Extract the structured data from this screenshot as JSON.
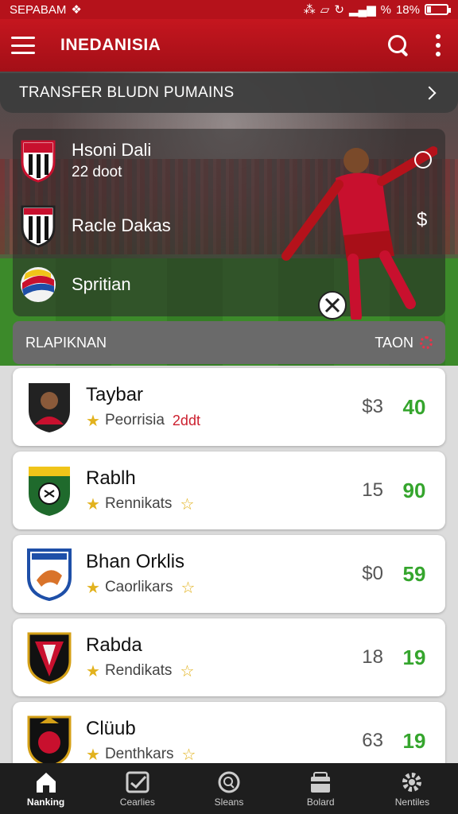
{
  "status_bar": {
    "time": "SEPABAM",
    "battery_text": "18%",
    "signal_text": "%",
    "battery_level": 0.18
  },
  "app_bar": {
    "title": "INEDANISIA",
    "menu_icon": "menu-icon",
    "search_icon": "search-icon",
    "more_icon": "more-vertical-icon"
  },
  "transfer": {
    "label": "TRANSFER BLUDN PUMAINS"
  },
  "clubs_panel": {
    "items": [
      {
        "name": "Hsoni Dali",
        "sub": "22 doot"
      },
      {
        "name": "Racle Dakas",
        "sub": ""
      },
      {
        "name": "Spritian",
        "sub": ""
      }
    ],
    "side_symbol": "$"
  },
  "ranking": {
    "title": "RLAPIKNAN",
    "right_label": "TAON"
  },
  "cards": [
    {
      "name": "Taybar",
      "meta": "Peorrisia",
      "extra": "2ddt",
      "price": "$3",
      "score": "40",
      "trail_star": false
    },
    {
      "name": "Rablh",
      "meta": "Rennikats",
      "extra": "",
      "price": "15",
      "score": "90",
      "trail_star": true
    },
    {
      "name": "Bhan Orklis",
      "meta": "Caorlikars",
      "extra": "",
      "price": "$0",
      "score": "59",
      "trail_star": true
    },
    {
      "name": "Rabda",
      "meta": "Rendikats",
      "extra": "",
      "price": "18",
      "score": "19",
      "trail_star": true
    },
    {
      "name": "Clüub",
      "meta": "Denthkars",
      "extra": "",
      "price": "63",
      "score": "19",
      "trail_star": true
    }
  ],
  "bottom_nav": [
    {
      "label": "Nanking",
      "icon": "home-icon"
    },
    {
      "label": "Cearlies",
      "icon": "checklist-icon"
    },
    {
      "label": "Sleans",
      "icon": "search-circle-icon"
    },
    {
      "label": "Bolard",
      "icon": "store-icon"
    },
    {
      "label": "Nentiles",
      "icon": "gear-icon"
    }
  ]
}
